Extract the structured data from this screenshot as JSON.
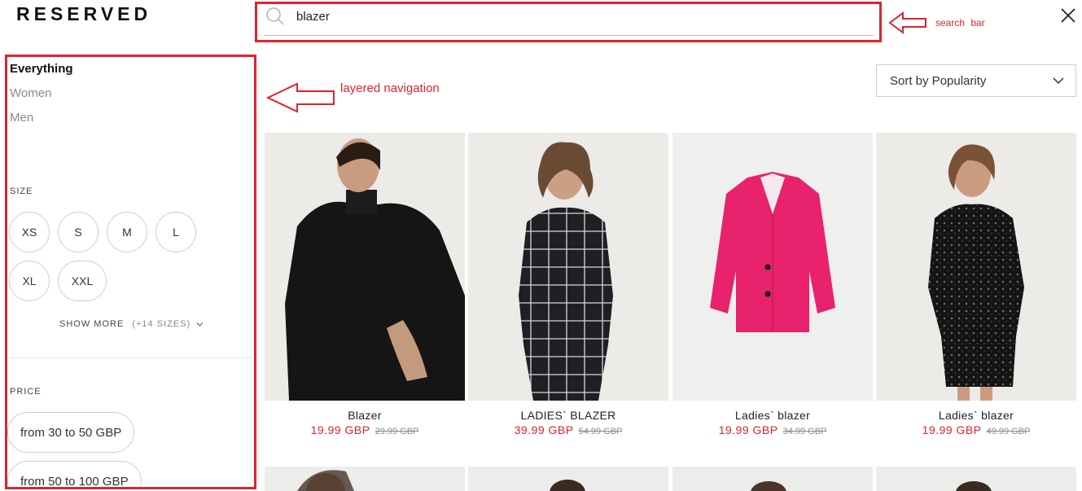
{
  "brand": {
    "logo": "RESERVED"
  },
  "search": {
    "value": "blazer",
    "placeholder": ""
  },
  "annotations": {
    "search_bar": "search bar",
    "layered_navigation": "layered navigation"
  },
  "nav": {
    "categories": [
      {
        "label": "Everything",
        "active": true
      },
      {
        "label": "Women",
        "active": false
      },
      {
        "label": "Men",
        "active": false
      }
    ]
  },
  "filters": {
    "size_title": "SIZE",
    "sizes": [
      "XS",
      "S",
      "M",
      "L",
      "XL",
      "XXL"
    ],
    "show_more": "SHOW MORE",
    "show_more_count": "(+14 SIZES)",
    "price_title": "PRICE",
    "prices": [
      "from 30 to 50 GBP",
      "from 50 to 100 GBP"
    ]
  },
  "sort": {
    "label": "Sort by Popularity"
  },
  "products": [
    {
      "name": "Blazer",
      "price": "19.99 GBP",
      "old_price": "29.99 GBP"
    },
    {
      "name": "LADIES` BLAZER",
      "price": "39.99 GBP",
      "old_price": "54.99 GBP"
    },
    {
      "name": "Ladies` blazer",
      "price": "19.99 GBP",
      "old_price": "34.99 GBP"
    },
    {
      "name": "Ladies` blazer",
      "price": "19.99 GBP",
      "old_price": "49.99 GBP"
    }
  ],
  "colors": {
    "accent_red": "#e0232b",
    "jacket_pink": "#e8226c"
  }
}
